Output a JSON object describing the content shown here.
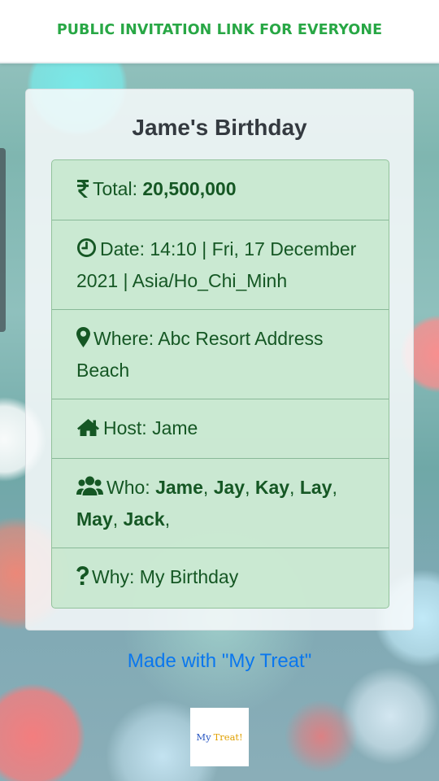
{
  "header": {
    "title": "PUBLIC INVITATION LINK FOR EVERYONE",
    "title_color": "#28a745"
  },
  "event": {
    "title": "Jame's Birthday",
    "total": {
      "icon": "rupee-icon",
      "label": "Total: ",
      "value": "20,500,000"
    },
    "date": {
      "icon": "clock-icon",
      "text": "Date: 14:10 | Fri, 17 December 2021 | Asia/Ho_Chi_Minh"
    },
    "where": {
      "icon": "map-marker-icon",
      "text": "Where: Abc Resort Address Beach"
    },
    "host": {
      "icon": "home-icon",
      "text": "Host: Jame"
    },
    "who": {
      "icon": "users-icon",
      "label": "Who: ",
      "guests": [
        "Jame",
        "Jay",
        "Kay",
        "Lay",
        "May",
        "Jack"
      ]
    },
    "why": {
      "icon": "question-icon",
      "text": "Why: My Birthday"
    }
  },
  "footer": {
    "made_with": "Made with \"My Treat\"",
    "link_color": "#0a77ee",
    "logo_my": "My",
    "logo_treat": "Treat!"
  },
  "colors": {
    "row_bg": "#c3e6cb",
    "row_text": "#155724"
  }
}
